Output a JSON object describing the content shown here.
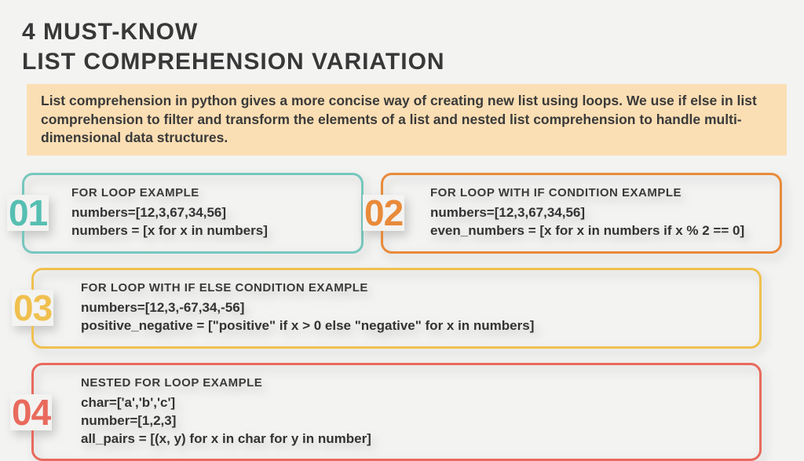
{
  "title_line1": "4 MUST-KNOW",
  "title_line2": "LIST COMPREHENSION VARIATION",
  "intro": "List comprehension in python gives a more concise way of creating new list using loops. We use if else in list comprehension to filter and transform the elements of a list and nested list comprehension to handle multi-dimensional data structures.",
  "cards": {
    "c1": {
      "num": "01",
      "title": "FOR LOOP EXAMPLE",
      "code": "numbers=[12,3,67,34,56]\nnumbers = [x for x in numbers]"
    },
    "c2": {
      "num": "02",
      "title": "FOR LOOP WITH IF CONDITION EXAMPLE",
      "code": "numbers=[12,3,67,34,56]\neven_numbers = [x for x in numbers if x % 2 == 0]"
    },
    "c3": {
      "num": "03",
      "title": "FOR LOOP WITH IF ELSE CONDITION EXAMPLE",
      "code": "numbers=[12,3,-67,34,-56]\npositive_negative = [\"positive\" if x > 0 else \"negative\" for x in numbers]"
    },
    "c4": {
      "num": "04",
      "title": "NESTED FOR LOOP EXAMPLE",
      "code": "char=['a','b','c']\nnumber=[1,2,3]\nall_pairs = [(x, y) for x in char for y in number]"
    }
  }
}
